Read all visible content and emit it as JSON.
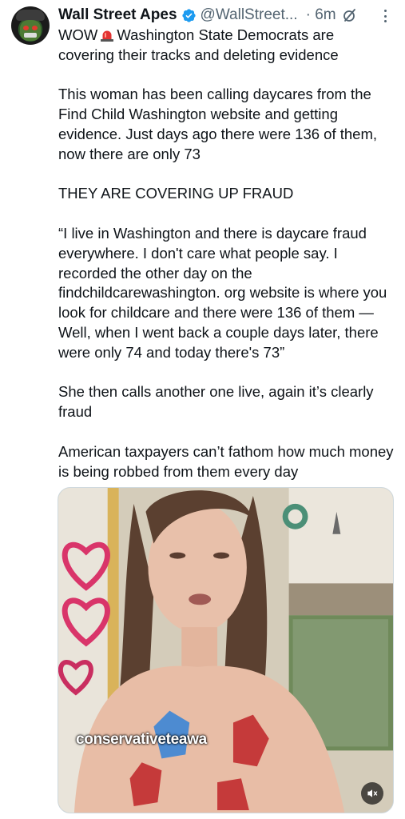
{
  "post": {
    "author_name": "Wall Street Apes",
    "author_handle": "@WallStreet...",
    "time": "· 6m",
    "paragraphs": [
      {
        "before_icon": "WOW",
        "icon": "siren-emoji",
        "after_icon": "Washington State Democrats are covering their tracks and deleting evidence"
      },
      "This woman has been calling daycares from the Find Child Washington website and getting evidence. Just days ago there were 136 of them, now there are only 73",
      "THEY ARE COVERING UP FRAUD",
      "“I live in Washington and there is daycare fraud everywhere. I don't care what people say. I recorded the other day on the findchildcarewashington. org website is where you look for childcare and there were 136 of them — Well, when I went back a couple days later, there were only 74 and today there's 73”",
      "She then calls another one live, again it’s clearly fraud",
      "American taxpayers can’t fathom how much money is being robbed from them every day"
    ]
  },
  "media": {
    "type": "video",
    "watermark": "conservativeteawa",
    "mute_icon": "muted-speaker-icon"
  },
  "icons": {
    "verified": "verified-badge-icon",
    "grok": "grok-icon",
    "more": "more-options-icon"
  },
  "colors": {
    "text": "#0f1419",
    "secondary": "#536471",
    "verified": "#1d9bf0"
  }
}
